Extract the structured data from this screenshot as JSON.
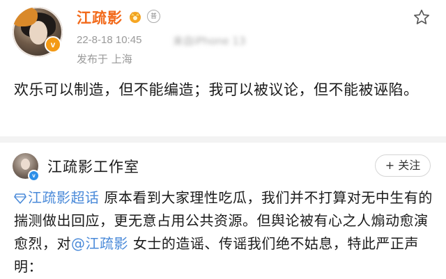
{
  "post1": {
    "username": "江疏影",
    "badge_letter": "v",
    "member_label": "普",
    "timestamp": "22-8-18 10:45",
    "source": "来自iPhone 13",
    "location": "发布于 上海",
    "text": "欢乐可以制造，但不能编造；我可以被议论，但不能被诬陷。"
  },
  "post2": {
    "username": "江疏影工作室",
    "badge_letter": "v",
    "follow_label": "+ 关注",
    "topic_link": "江疏影超话",
    "text_part1": " 原本看到大家理性吃瓜，我们并不打算对无中生有的揣测做出回应，更无意占用公共资源。但舆论被有心之人煽动愈演愈烈，对",
    "mention_link": "@江疏影",
    "text_part2": " 女士的造谣、传谣我们绝不姑息，特此严正声明："
  },
  "colors": {
    "username_orange": "#f26a1b",
    "link_blue": "#4a8ad9",
    "verified_orange": "#f39a16",
    "verified_blue": "#2d8fe8"
  },
  "icons": [
    "crown-icon",
    "member-icon",
    "star-icon",
    "topic-diamond-icon",
    "verified-badge-icon"
  ]
}
